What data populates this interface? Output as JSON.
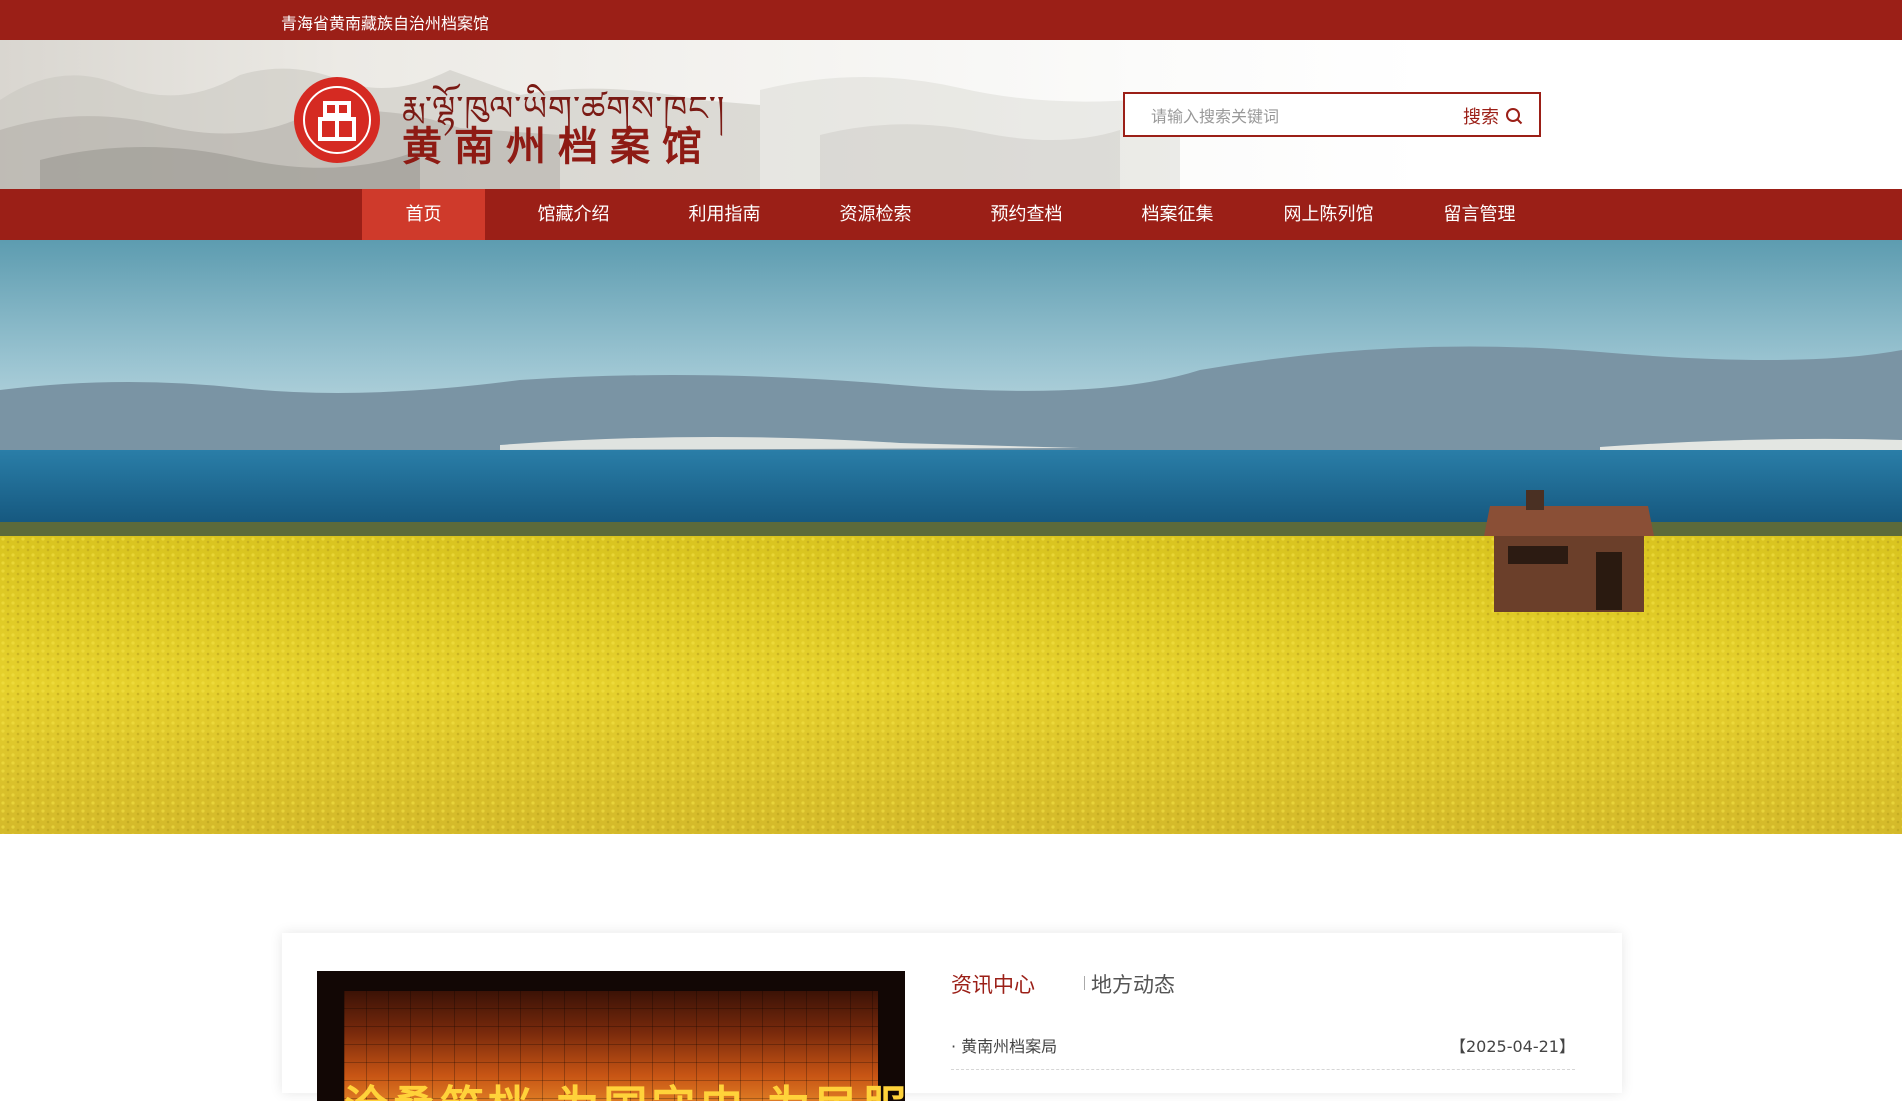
{
  "topbar": {
    "org_name": "青海省黄南藏族自治州档案馆"
  },
  "header": {
    "logo_tibetan": "རྨ་ལྷོ་ཁུལ་ཡིག་ཚགས་ཁང་།",
    "logo_title": "黄南州档案馆",
    "search": {
      "placeholder": "请输入搜索关键词",
      "button_label": "搜索"
    }
  },
  "nav": {
    "items": [
      {
        "label": "首页",
        "active": true
      },
      {
        "label": "馆藏介绍"
      },
      {
        "label": "利用指南"
      },
      {
        "label": "资源检索"
      },
      {
        "label": "预约查档"
      },
      {
        "label": "档案征集"
      },
      {
        "label": "网上陈列馆"
      },
      {
        "label": "留言管理"
      }
    ]
  },
  "content": {
    "video_caption": "沧桑筑档 为国守史 为民服务",
    "tabs": [
      {
        "label": "资讯中心",
        "active": true
      },
      {
        "label": "地方动态",
        "active": false
      }
    ],
    "news": [
      {
        "title": "· 黄南州档案局",
        "date": "【2025-04-21】"
      }
    ]
  },
  "colors": {
    "primary": "#9b1f17",
    "nav_active": "#cf3a2b",
    "field_yellow": "#e6d12c",
    "lake_blue": "#1f6c96"
  }
}
